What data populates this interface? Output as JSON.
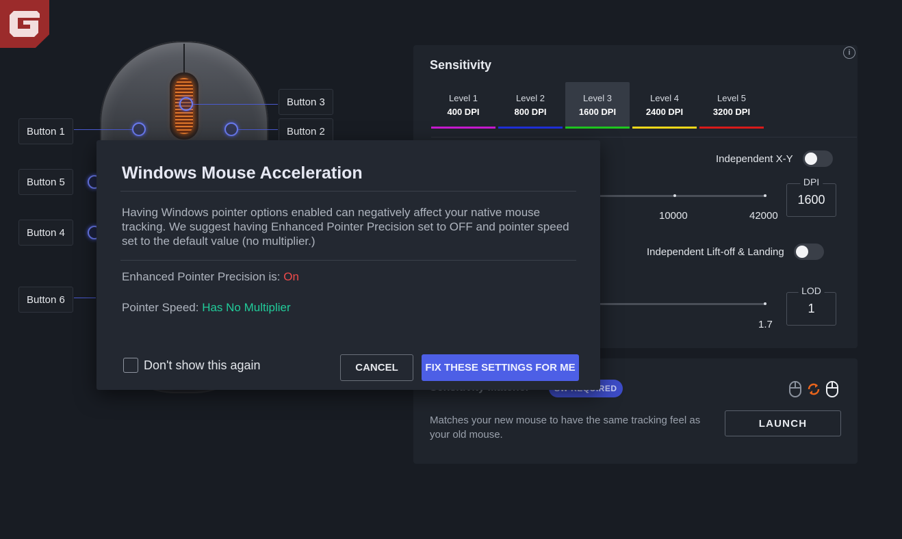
{
  "logo": {
    "icon": "brand-logo-icon",
    "color": "#9b2b2b"
  },
  "mouse": {
    "button_labels": [
      "Button 1",
      "Button 2",
      "Button 3",
      "Button 4",
      "Button 5",
      "Button 6"
    ]
  },
  "sensitivity": {
    "title": "Sensitivity",
    "levels": [
      {
        "name": "Level 1",
        "dpi": "400 DPI",
        "color": "#c81ad0"
      },
      {
        "name": "Level 2",
        "dpi": "800 DPI",
        "color": "#1f2fd8"
      },
      {
        "name": "Level 3",
        "dpi": "1600 DPI",
        "color": "#1fc61f",
        "active": true
      },
      {
        "name": "Level 4",
        "dpi": "2400 DPI",
        "color": "#f0d81a"
      },
      {
        "name": "Level 5",
        "dpi": "3200 DPI",
        "color": "#d81a1a"
      }
    ],
    "independent_xy_label": "Independent X-Y",
    "dpi_ticks": [
      "10000",
      "42000"
    ],
    "dpi_box_label": "DPI",
    "dpi_value": "1600",
    "liftoff_label": "Independent Lift-off & Landing",
    "lod_tick": "1.7",
    "lod_box_label": "LOD",
    "lod_value": "1"
  },
  "matcher": {
    "title": "Sensitivity Matcher",
    "badge": "SW REQUIRED",
    "description": "Matches your new mouse to have the same tracking feel as your old mouse.",
    "launch_label": "LAUNCH",
    "accent_color": "#e8641c"
  },
  "modal": {
    "title": "Windows Mouse Acceleration",
    "body": "Having Windows pointer options enabled can negatively affect your native mouse tracking. We suggest having Enhanced Pointer Precision set to OFF and pointer speed set to the default value (no multiplier.)",
    "precision_label": "Enhanced Pointer Precision is: ",
    "precision_value": "On",
    "speed_label": "Pointer Speed: ",
    "speed_value": "Has No Multiplier",
    "dont_show_label": "Don't show this again",
    "cancel_label": "CANCEL",
    "fix_label": "FIX THESE SETTINGS FOR ME",
    "colors": {
      "on": "#ee4a4a",
      "ok": "#21cc9a",
      "primary": "#4d5fe6"
    }
  }
}
